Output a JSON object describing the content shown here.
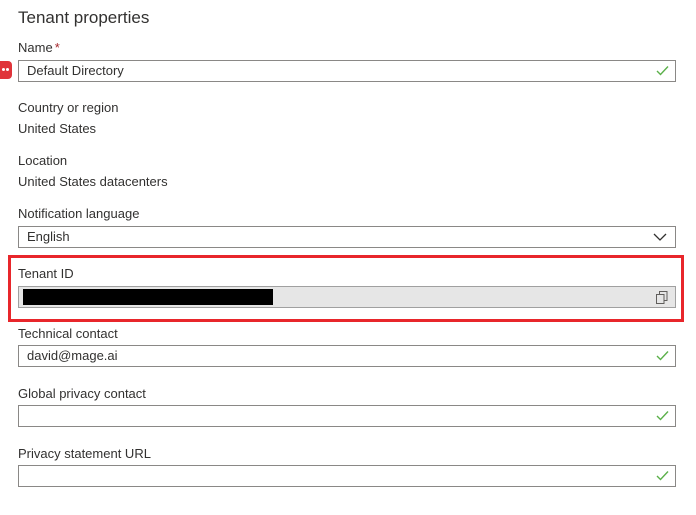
{
  "page": {
    "title": "Tenant properties"
  },
  "name": {
    "label": "Name",
    "required_mark": "*",
    "value": "Default Directory"
  },
  "country": {
    "label": "Country or region",
    "value": "United States"
  },
  "location": {
    "label": "Location",
    "value": "United States datacenters"
  },
  "notification_language": {
    "label": "Notification language",
    "value": "English"
  },
  "tenant_id": {
    "label": "Tenant ID",
    "value_redacted": true
  },
  "technical_contact": {
    "label": "Technical contact",
    "value": "david@mage.ai"
  },
  "global_privacy_contact": {
    "label": "Global privacy contact",
    "value": ""
  },
  "privacy_statement_url": {
    "label": "Privacy statement URL",
    "value": ""
  },
  "colors": {
    "highlight": "#e8262b",
    "valid_check": "#5bb04a",
    "required": "#a4262c"
  },
  "icons": [
    "checkmark-icon",
    "chevron-down-icon",
    "copy-icon"
  ]
}
